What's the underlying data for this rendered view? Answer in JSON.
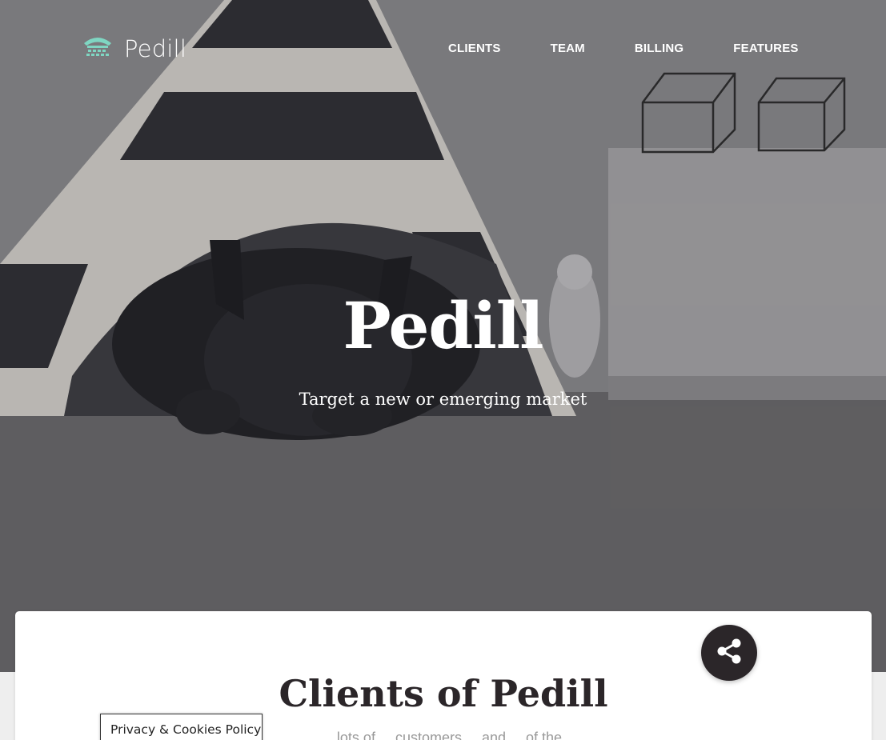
{
  "brand": {
    "name": "Pedill",
    "logo_icon": "vintage-phone-icon",
    "accent_color": "#7fd6c2"
  },
  "nav": {
    "items": [
      "CLIENTS",
      "TEAM",
      "BILLING",
      "FEATURES"
    ]
  },
  "hero": {
    "title": "Pedill",
    "subtitle": "Target a new or emerging market"
  },
  "clients_section": {
    "title": "Clients of Pedill",
    "intro_partial": "...lots of ... customers ... and ... of the"
  },
  "share_button": {
    "icon": "share-icon",
    "color": "#2b2629"
  },
  "cookie_notice": {
    "label": "Privacy & Cookies Policy"
  }
}
